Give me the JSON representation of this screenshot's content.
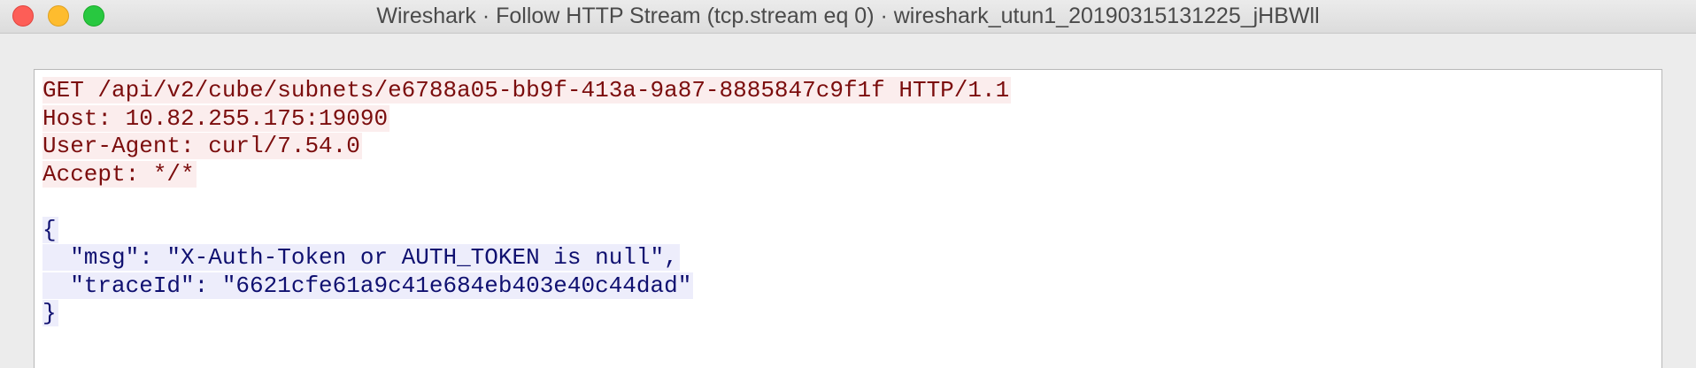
{
  "window": {
    "title": "Wireshark · Follow HTTP Stream (tcp.stream eq 0) · wireshark_utun1_20190315131225_jHBWll"
  },
  "stream": {
    "client_lines": [
      "GET /api/v2/cube/subnets/e6788a05-bb9f-413a-9a87-8885847c9f1f HTTP/1.1",
      "Host: 10.82.255.175:19090",
      "User-Agent: curl/7.54.0",
      "Accept: */*"
    ],
    "server_lines": [
      "{",
      "  \"msg\": \"X-Auth-Token or AUTH_TOKEN is null\",",
      "  \"traceId\": \"6621cfe61a9c41e684eb403e40c44dad\"",
      "}"
    ],
    "colors": {
      "client_text": "#7b0d0d",
      "client_bg": "#fbeded",
      "server_text": "#0f1070",
      "server_bg": "#ededfb"
    }
  }
}
